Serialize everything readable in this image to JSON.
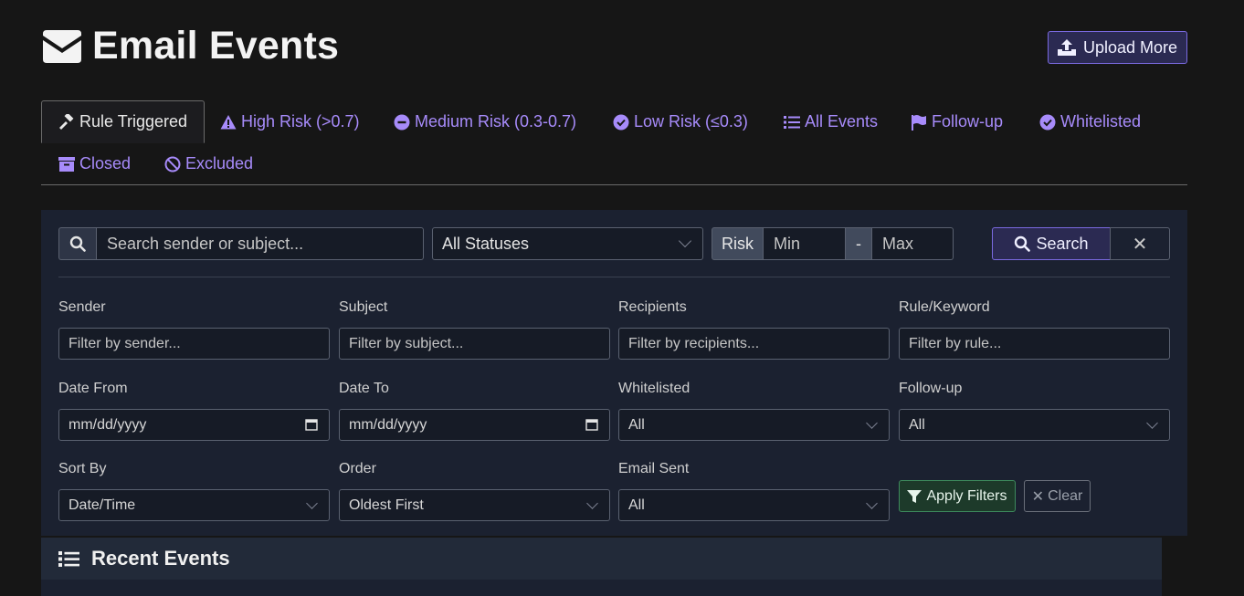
{
  "header": {
    "title": "Email Events",
    "upload_label": "Upload More"
  },
  "tabs": [
    {
      "label": "Rule Triggered",
      "icon": "gavel-icon",
      "active": true
    },
    {
      "label": "High Risk (>0.7)",
      "icon": "warning-icon"
    },
    {
      "label": "Medium Risk (0.3-0.7)",
      "icon": "minus-circle-icon"
    },
    {
      "label": "Low Risk (≤0.3)",
      "icon": "check-circle-icon"
    },
    {
      "label": "All Events",
      "icon": "list-icon"
    },
    {
      "label": "Follow-up",
      "icon": "flag-icon"
    },
    {
      "label": "Whitelisted",
      "icon": "check-circle-icon"
    },
    {
      "label": "Closed",
      "icon": "archive-icon"
    },
    {
      "label": "Excluded",
      "icon": "ban-icon"
    }
  ],
  "search": {
    "placeholder": "Search sender or subject...",
    "status_value": "All Statuses",
    "risk_label": "Risk",
    "risk_min_placeholder": "Min",
    "risk_separator": "-",
    "risk_max_placeholder": "Max",
    "search_label": "Search",
    "reset_label": "✕"
  },
  "filters": {
    "sender": {
      "label": "Sender",
      "placeholder": "Filter by sender..."
    },
    "subject": {
      "label": "Subject",
      "placeholder": "Filter by subject..."
    },
    "recipients": {
      "label": "Recipients",
      "placeholder": "Filter by recipients..."
    },
    "rule": {
      "label": "Rule/Keyword",
      "placeholder": "Filter by rule..."
    },
    "date_from": {
      "label": "Date From",
      "value": "mm/dd/yyyy"
    },
    "date_to": {
      "label": "Date To",
      "value": "mm/dd/yyyy"
    },
    "whitelisted": {
      "label": "Whitelisted",
      "value": "All"
    },
    "followup": {
      "label": "Follow-up",
      "value": "All"
    },
    "sort_by": {
      "label": "Sort By",
      "value": "Date/Time"
    },
    "order": {
      "label": "Order",
      "value": "Oldest First"
    },
    "email_sent": {
      "label": "Email Sent",
      "value": "All"
    },
    "apply_label": "Apply Filters",
    "clear_label": "Clear"
  },
  "recent": {
    "title": "Recent Events"
  },
  "colors": {
    "accent": "#a78bfa",
    "panel": "#1b2130",
    "background": "#161616",
    "apply_green": "#3d8a5c"
  }
}
